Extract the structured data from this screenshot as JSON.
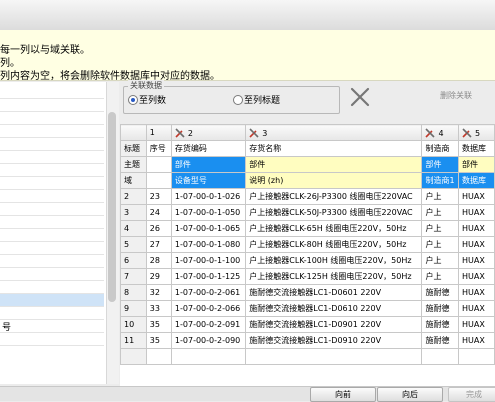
{
  "notice": {
    "line1": "每一列以与域关联。",
    "line2": "列。",
    "line3": "列内容为空，将会删除软件数据库中对应的数据。"
  },
  "left_list": {
    "rows": [
      "",
      "",
      "",
      "",
      "",
      "",
      "",
      "",
      "",
      "",
      "",
      "",
      "",
      "",
      "",
      "",
      "",
      "",
      "号",
      ""
    ]
  },
  "group": {
    "label": "关联数据",
    "option1": "至列数",
    "option2": "至列标题"
  },
  "toolbar": {
    "delete_label": "删除关联"
  },
  "grid": {
    "column_numbers": [
      "",
      "1",
      "2",
      "3",
      "4",
      "5"
    ],
    "rows": [
      [
        "标题",
        "序号",
        "存货编码",
        "存货名称",
        "制造商",
        "数据库"
      ],
      [
        "主题",
        "",
        "部件",
        "部件",
        "部件",
        "部件"
      ],
      [
        "域",
        "",
        "设备型号",
        "说明 (zh)",
        "制造商1",
        "数据库"
      ],
      [
        "2",
        "23",
        "1-07-00-0-1-026",
        "户上接触器CLK-26J-P3300  线圈电压220VAC",
        "户上",
        "HUAX"
      ],
      [
        "3",
        "24",
        "1-07-00-0-1-050",
        "户上接触器CLK-50J-P3300  线圈电压220VAC",
        "户上",
        "HUAX"
      ],
      [
        "4",
        "26",
        "1-07-00-0-1-065",
        "户上接触器CLK-65H    线圈电压220V，50Hz",
        "户上",
        "HUAX"
      ],
      [
        "5",
        "27",
        "1-07-00-0-1-080",
        "户上接触器CLK-80H    线圈电压220V，50Hz",
        "户上",
        "HUAX"
      ],
      [
        "6",
        "28",
        "1-07-00-0-1-100",
        "户上接触器CLK-100H    线圈电压220V，50Hz",
        "户上",
        "HUAX"
      ],
      [
        "7",
        "29",
        "1-07-00-0-1-125",
        "户上接触器CLK-125H    线圈电压220V，50Hz",
        "户上",
        "HUAX"
      ],
      [
        "8",
        "32",
        "1-07-00-0-2-061",
        "施耐德交流接触器LC1-D0601 220V",
        "施耐德",
        "HUAX"
      ],
      [
        "9",
        "33",
        "1-07-00-0-2-066",
        "施耐德交流接触器LC1-D0610 220V",
        "施耐德",
        "HUAX"
      ],
      [
        "10",
        "35",
        "1-07-00-0-2-091",
        "施耐德交流接触器LC1-D0901 220V",
        "施耐德",
        "HUAX"
      ],
      [
        "11",
        "35",
        "1-07-00-0-2-090",
        "施耐德交流接触器LC1-D0910 220V",
        "施耐德",
        "HUAX"
      ],
      [
        "",
        "",
        "",
        "",
        "",
        ""
      ]
    ]
  },
  "buttons": {
    "prev": "向前",
    "next": "向后",
    "finish": "完成"
  },
  "colors": {
    "highlight_blue": "#1a8ff0",
    "highlight_yellow": "#fffdc0",
    "notice_bg": "#ffffe3"
  }
}
